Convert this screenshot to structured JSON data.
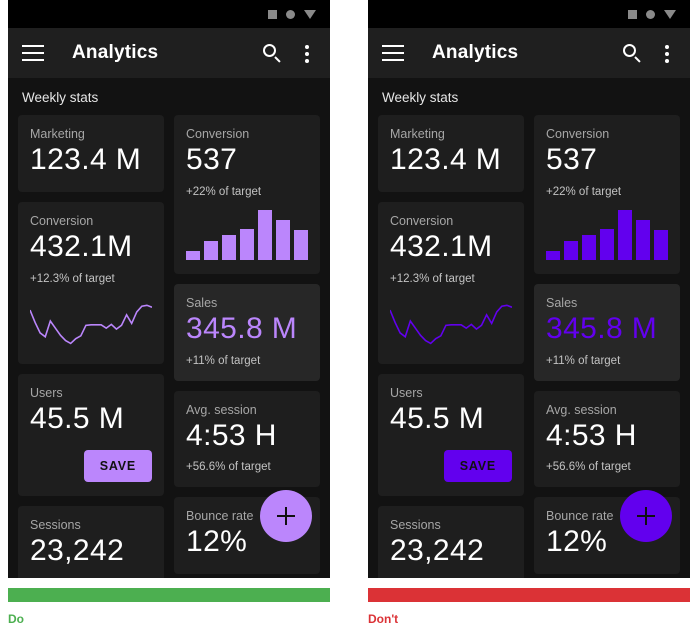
{
  "examples": [
    {
      "id": "do",
      "statusbar": {
        "icons": [
          "square-icon",
          "circle-icon",
          "triangle-down-icon"
        ]
      },
      "appbar": {
        "menu_icon": "hamburger-menu-icon",
        "title": "Analytics",
        "search_icon": "search-icon",
        "overflow_icon": "more-vertical-icon"
      },
      "section_title": "Weekly stats",
      "accent": "#bb86fc",
      "on_accent_text": "#111111",
      "cards": {
        "marketing": {
          "label": "Marketing",
          "value": "123.4 M"
        },
        "conversion_r": {
          "label": "Conversion",
          "value": "537",
          "sub": "+22% of target"
        },
        "conversion_l": {
          "label": "Conversion",
          "value": "432.1M",
          "sub": "+12.3% of target"
        },
        "sales": {
          "label": "Sales",
          "value": "345.8 M",
          "sub": "+11% of target"
        },
        "users": {
          "label": "Users",
          "value": "45.5 M",
          "save_label": "SAVE"
        },
        "avg_session": {
          "label": "Avg. session",
          "value": "4:53 H",
          "sub": "+56.6% of target"
        },
        "sessions": {
          "label": "Sessions",
          "value": "23,242"
        },
        "bounce": {
          "label": "Bounce rate",
          "value": "12%"
        }
      },
      "fab": {
        "icon": "plus-icon"
      },
      "verdict": {
        "label": "Do",
        "color": "#4caf50"
      }
    },
    {
      "id": "dont",
      "statusbar": {
        "icons": [
          "square-icon",
          "circle-icon",
          "triangle-down-icon"
        ]
      },
      "appbar": {
        "menu_icon": "hamburger-menu-icon",
        "title": "Analytics",
        "search_icon": "search-icon",
        "overflow_icon": "more-vertical-icon"
      },
      "section_title": "Weekly stats",
      "accent": "#6200ee",
      "on_accent_text": "#111111",
      "cards": {
        "marketing": {
          "label": "Marketing",
          "value": "123.4 M"
        },
        "conversion_r": {
          "label": "Conversion",
          "value": "537",
          "sub": "+22% of target"
        },
        "conversion_l": {
          "label": "Conversion",
          "value": "432.1M",
          "sub": "+12.3% of target"
        },
        "sales": {
          "label": "Sales",
          "value": "345.8 M",
          "sub": "+11% of target"
        },
        "users": {
          "label": "Users",
          "value": "45.5 M",
          "save_label": "SAVE"
        },
        "avg_session": {
          "label": "Avg. session",
          "value": "4:53 H",
          "sub": "+56.6% of target"
        },
        "sessions": {
          "label": "Sessions",
          "value": "23,242"
        },
        "bounce": {
          "label": "Bounce rate",
          "value": "12%"
        }
      },
      "fab": {
        "icon": "plus-icon"
      },
      "verdict": {
        "label": "Don't",
        "color": "#db3236"
      }
    }
  ],
  "chart_data": [
    {
      "type": "bar",
      "title": "Conversion",
      "categories": [
        "1",
        "2",
        "3",
        "4",
        "5",
        "6",
        "7"
      ],
      "values": [
        18,
        38,
        50,
        62,
        100,
        80,
        60
      ],
      "xlabel": "",
      "ylabel": "",
      "ylim": [
        0,
        100
      ],
      "grid": false,
      "legend": "none"
    },
    {
      "type": "line",
      "title": "Conversion",
      "x": [
        0,
        1,
        2,
        3,
        4,
        5,
        6,
        7,
        8,
        9,
        10,
        11,
        12,
        13,
        14,
        15,
        16,
        17,
        18,
        19,
        20,
        21,
        22,
        23,
        24
      ],
      "y": [
        78,
        52,
        30,
        22,
        55,
        40,
        25,
        14,
        8,
        18,
        24,
        46,
        47,
        47,
        47,
        40,
        48,
        38,
        46,
        68,
        50,
        74,
        86,
        88,
        84
      ],
      "xlabel": "",
      "ylabel": "",
      "ylim": [
        0,
        100
      ],
      "grid": false,
      "legend": "none"
    }
  ]
}
